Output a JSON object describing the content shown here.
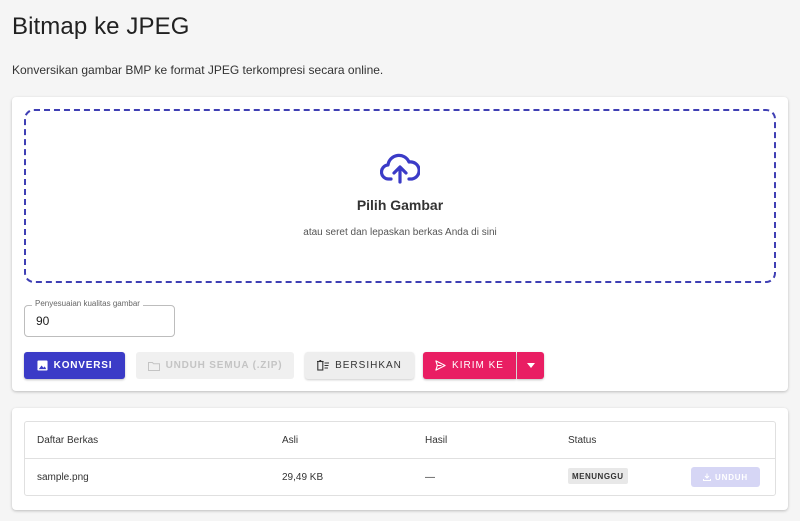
{
  "header": {
    "title": "Bitmap ke JPEG",
    "subtitle": "Konversikan gambar BMP ke format JPEG terkompresi secara online."
  },
  "dropzone": {
    "icon": "cloud-upload-icon",
    "title": "Pilih Gambar",
    "hint": "atau seret dan lepaskan berkas Anda di sini"
  },
  "quality": {
    "label": "Penyesuaian kualitas gambar",
    "value": "90"
  },
  "toolbar": {
    "convert_label": "Konversi",
    "download_all_label": "Unduh Semua (.ZIP)",
    "clear_label": "Bersihkan",
    "send_label": "Kirim Ke"
  },
  "files": {
    "columns": [
      "Daftar Berkas",
      "Asli",
      "Hasil",
      "Status"
    ],
    "rows": [
      {
        "name": "sample.png",
        "original": "29,49 KB",
        "result": "—",
        "status": "MENUNGGU",
        "download_label": "UNDUH"
      }
    ]
  },
  "colors": {
    "primary": "#3b3bc7",
    "accent": "#e91e63",
    "dropzone_border": "#3f3fb4"
  }
}
